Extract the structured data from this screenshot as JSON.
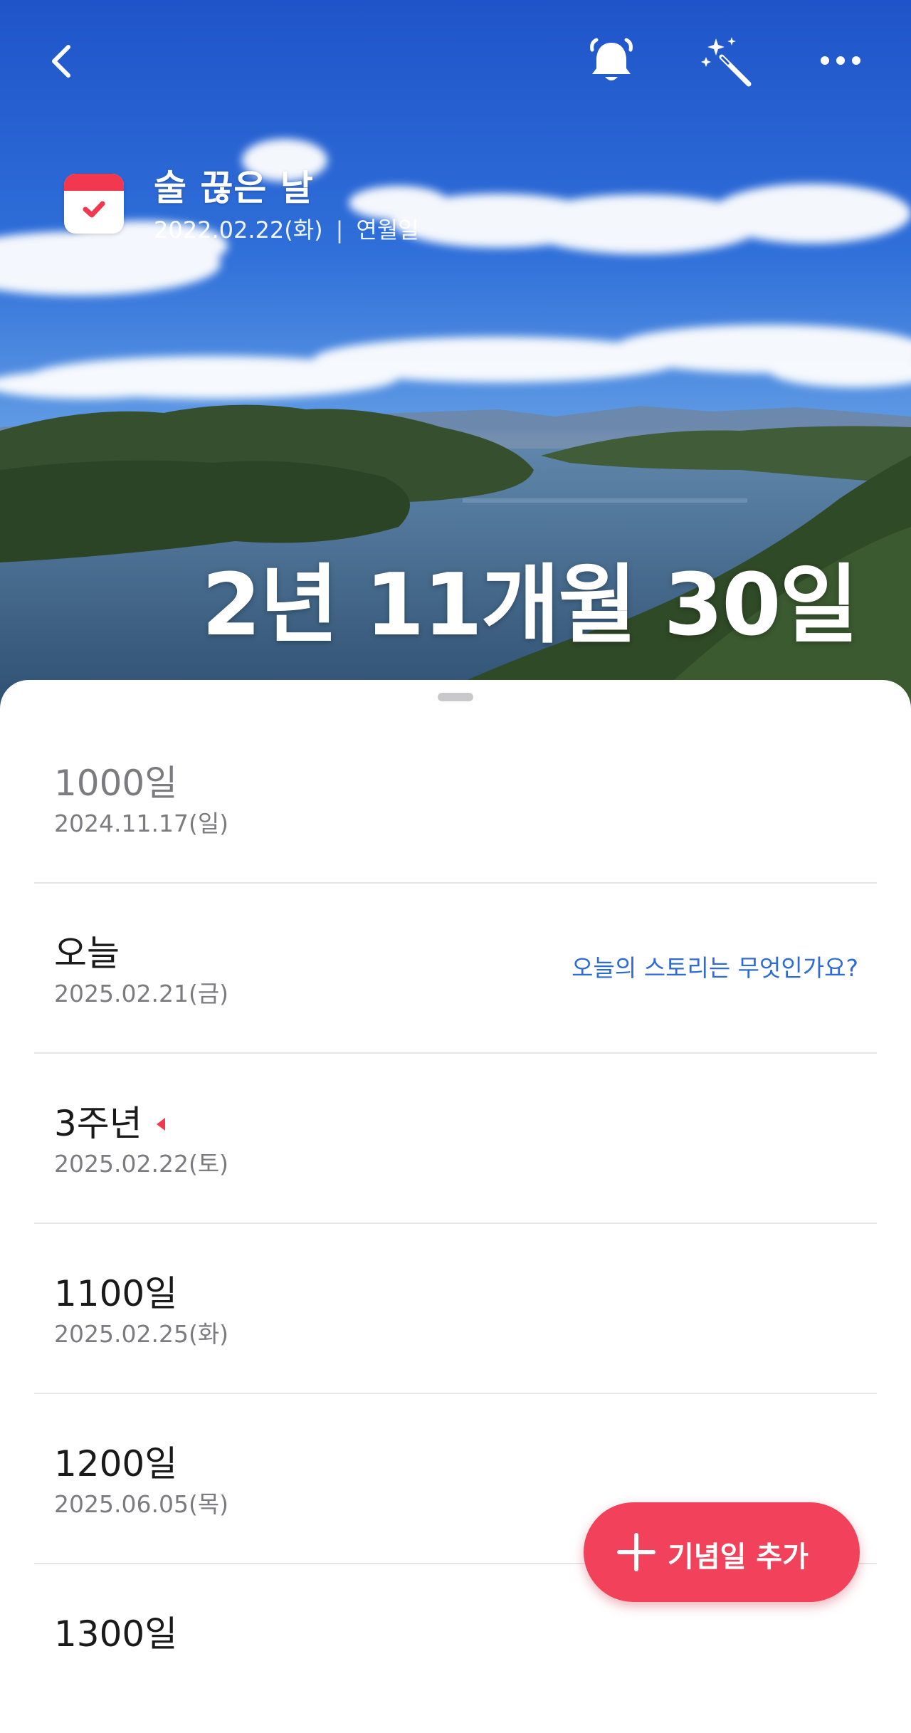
{
  "hero": {
    "title": "술 끊은 날",
    "date": "2022.02.22(화)",
    "separator": "|",
    "mode": "연월일",
    "counter": "2년 11개월 30일"
  },
  "topbar": {
    "back_icon": "chevron-left-icon",
    "alarm_icon": "alarm-bell-icon",
    "decorate_icon": "magic-wand-icon",
    "more_icon": "more-dots-icon"
  },
  "milestones": [
    {
      "label": "1000일",
      "date": "2024.11.17(일)",
      "state": "past"
    },
    {
      "label": "오늘",
      "date": "2025.02.21(금)",
      "link": "오늘의 스토리는 무엇인가요?"
    },
    {
      "label": "3주년",
      "date": "2025.02.22(토)",
      "marker": "red-triangle-icon"
    },
    {
      "label": "1100일",
      "date": "2025.02.25(화)"
    },
    {
      "label": "1200일",
      "date": "2025.06.05(목)"
    },
    {
      "label": "1300일",
      "date": ""
    }
  ],
  "fab": {
    "label": "기념일 추가",
    "icon": "plus-icon"
  },
  "colors": {
    "accent": "#f2415a",
    "link": "#2f6bd6",
    "muted": "#7b7b80"
  }
}
